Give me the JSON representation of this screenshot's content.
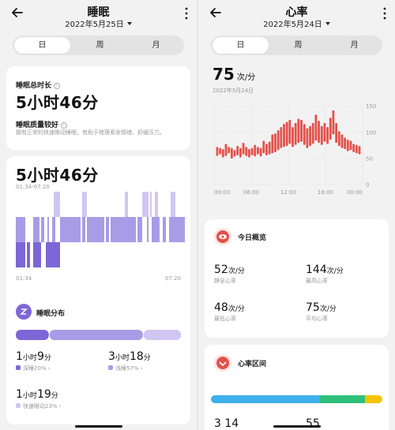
{
  "sleep": {
    "title": "睡眠",
    "date": "2022年5月25日",
    "tabs": [
      "日",
      "周",
      "月"
    ],
    "total_label": "睡眠总时长",
    "total_value": "5小时46分",
    "quality_label": "睡眠质量较好",
    "quality_desc": "拥有正常的快速眼动睡眠，有助于梳理紧张情绪、舒缓压力。",
    "detail_value": "5小时46分",
    "detail_range": "01:34-07:20",
    "axis_start": "01:34",
    "axis_end": "07:20",
    "dist_title": "睡眠分布",
    "stats": [
      {
        "hours": "1",
        "h_unit": "小时",
        "mins": "9",
        "m_unit": "分",
        "label": "深睡20%"
      },
      {
        "hours": "3",
        "h_unit": "小时",
        "mins": "18",
        "m_unit": "分",
        "label": "浅睡57%"
      },
      {
        "hours": "1",
        "h_unit": "小时",
        "mins": "19",
        "m_unit": "分",
        "label": "快速眼动23%"
      }
    ],
    "stage_colors": {
      "deep": "#7b68d6",
      "light": "#a99ce6",
      "rem": "#cfc7f2"
    },
    "stage_shares": {
      "deep": 0.2,
      "light": 0.57,
      "rem": 0.23
    }
  },
  "heart": {
    "title": "心率",
    "date": "2022年5月24日",
    "tabs": [
      "日",
      "周",
      "月"
    ],
    "current_value": "75",
    "current_unit": "次/分",
    "current_date": "2022年5月24日",
    "overview_title": "今日概览",
    "overview": [
      {
        "value": "52",
        "unit": "次/分",
        "label": "静息心率"
      },
      {
        "value": "144",
        "unit": "次/分",
        "label": "最高心率"
      },
      {
        "value": "48",
        "unit": "次/分",
        "label": "最低心率"
      },
      {
        "value": "75",
        "unit": "次/分",
        "label": "平均心率"
      }
    ],
    "zones_title": "心率区间",
    "zones_partial": [
      "3",
      "14",
      "55"
    ],
    "zone_colors": [
      "#3fb0ec",
      "#2fc07a",
      "#f5c400"
    ],
    "accent": "#e3514b"
  },
  "chart_data": {
    "type": "bar",
    "x_ticks": [
      "00:00",
      "06:00",
      "12:00",
      "18:00",
      "00:00"
    ],
    "y_ticks": [
      0,
      50,
      100,
      150
    ],
    "ylim": [
      0,
      160
    ],
    "series": [
      {
        "ranges": [
          [
            55,
            72
          ],
          [
            58,
            70
          ],
          [
            52,
            68
          ],
          [
            55,
            78
          ],
          [
            60,
            72
          ],
          [
            50,
            70
          ],
          [
            54,
            66
          ],
          [
            56,
            74
          ],
          [
            52,
            70
          ],
          [
            58,
            80
          ],
          [
            55,
            72
          ],
          [
            52,
            68
          ],
          [
            56,
            70
          ],
          [
            54,
            76
          ],
          [
            58,
            72
          ],
          [
            54,
            70
          ],
          [
            60,
            84
          ],
          [
            56,
            78
          ],
          [
            58,
            82
          ],
          [
            60,
            96
          ],
          [
            62,
            98
          ],
          [
            66,
            104
          ],
          [
            70,
            110
          ],
          [
            72,
            116
          ],
          [
            74,
            120
          ],
          [
            78,
            124
          ],
          [
            72,
            110
          ],
          [
            76,
            118
          ],
          [
            80,
            126
          ],
          [
            82,
            124
          ],
          [
            76,
            116
          ],
          [
            70,
            108
          ],
          [
            74,
            112
          ],
          [
            78,
            118
          ],
          [
            84,
            134
          ],
          [
            80,
            122
          ],
          [
            76,
            112
          ],
          [
            82,
            118
          ],
          [
            78,
            110
          ],
          [
            86,
            128
          ],
          [
            96,
            142
          ],
          [
            80,
            118
          ],
          [
            74,
            102
          ],
          [
            70,
            96
          ],
          [
            68,
            90
          ],
          [
            64,
            86
          ],
          [
            66,
            84
          ],
          [
            62,
            78
          ],
          [
            60,
            76
          ],
          [
            58,
            74
          ]
        ]
      }
    ]
  }
}
